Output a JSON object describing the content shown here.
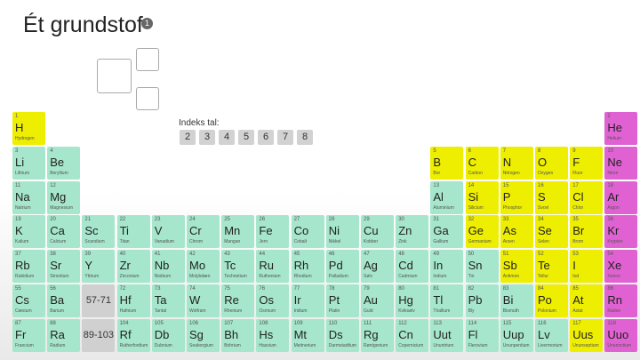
{
  "header": {
    "title": "Ét grundstof",
    "badge": "1"
  },
  "index_label": "Indeks tal:",
  "index_buttons": [
    "2",
    "3",
    "4",
    "5",
    "6",
    "7",
    "8"
  ],
  "ranges": [
    "57-71",
    "89-103"
  ],
  "colors": {
    "metal": "#a5e6cc",
    "nonmetal": "#eeee00",
    "noble": "#e062d2",
    "range": "#d0d0d0"
  },
  "elements": [
    {
      "n": "1",
      "s": "H",
      "name": "Hydrogen",
      "t": "nonmetal"
    },
    {
      "n": "2",
      "s": "He",
      "name": "Helium",
      "t": "noble"
    },
    {
      "n": "3",
      "s": "Li",
      "name": "Lithium",
      "t": "metal"
    },
    {
      "n": "4",
      "s": "Be",
      "name": "Beryllium",
      "t": "metal"
    },
    {
      "n": "5",
      "s": "B",
      "name": "Bor",
      "t": "nonmetal"
    },
    {
      "n": "6",
      "s": "C",
      "name": "Carbon",
      "t": "nonmetal"
    },
    {
      "n": "7",
      "s": "N",
      "name": "Nitrogen",
      "t": "nonmetal"
    },
    {
      "n": "8",
      "s": "O",
      "name": "Oxygen",
      "t": "nonmetal"
    },
    {
      "n": "9",
      "s": "F",
      "name": "Fluor",
      "t": "nonmetal"
    },
    {
      "n": "10",
      "s": "Ne",
      "name": "Neon",
      "t": "noble"
    },
    {
      "n": "11",
      "s": "Na",
      "name": "Natrium",
      "t": "metal"
    },
    {
      "n": "12",
      "s": "Mg",
      "name": "Magnesium",
      "t": "metal"
    },
    {
      "n": "13",
      "s": "Al",
      "name": "Aluminium",
      "t": "metal"
    },
    {
      "n": "14",
      "s": "Si",
      "name": "Silicium",
      "t": "nonmetal"
    },
    {
      "n": "15",
      "s": "P",
      "name": "Phosphor",
      "t": "nonmetal"
    },
    {
      "n": "16",
      "s": "S",
      "name": "Svovl",
      "t": "nonmetal"
    },
    {
      "n": "17",
      "s": "Cl",
      "name": "Chlor",
      "t": "nonmetal"
    },
    {
      "n": "18",
      "s": "Ar",
      "name": "Argon",
      "t": "noble"
    },
    {
      "n": "19",
      "s": "K",
      "name": "Kalium",
      "t": "metal"
    },
    {
      "n": "20",
      "s": "Ca",
      "name": "Calcium",
      "t": "metal"
    },
    {
      "n": "21",
      "s": "Sc",
      "name": "Scandium",
      "t": "metal"
    },
    {
      "n": "22",
      "s": "Ti",
      "name": "Titan",
      "t": "metal"
    },
    {
      "n": "23",
      "s": "V",
      "name": "Vanadium",
      "t": "metal"
    },
    {
      "n": "24",
      "s": "Cr",
      "name": "Chrom",
      "t": "metal"
    },
    {
      "n": "25",
      "s": "Mn",
      "name": "Mangan",
      "t": "metal"
    },
    {
      "n": "26",
      "s": "Fe",
      "name": "Jern",
      "t": "metal"
    },
    {
      "n": "27",
      "s": "Co",
      "name": "Cobalt",
      "t": "metal"
    },
    {
      "n": "28",
      "s": "Ni",
      "name": "Nikkel",
      "t": "metal"
    },
    {
      "n": "29",
      "s": "Cu",
      "name": "Kobber",
      "t": "metal"
    },
    {
      "n": "30",
      "s": "Zn",
      "name": "Zink",
      "t": "metal"
    },
    {
      "n": "31",
      "s": "Ga",
      "name": "Gallium",
      "t": "metal"
    },
    {
      "n": "32",
      "s": "Ge",
      "name": "Germanium",
      "t": "nonmetal"
    },
    {
      "n": "33",
      "s": "As",
      "name": "Arsen",
      "t": "nonmetal"
    },
    {
      "n": "34",
      "s": "Se",
      "name": "Selen",
      "t": "nonmetal"
    },
    {
      "n": "35",
      "s": "Br",
      "name": "Brom",
      "t": "nonmetal"
    },
    {
      "n": "36",
      "s": "Kr",
      "name": "Krypton",
      "t": "noble"
    },
    {
      "n": "37",
      "s": "Rb",
      "name": "Rubidium",
      "t": "metal"
    },
    {
      "n": "38",
      "s": "Sr",
      "name": "Strontium",
      "t": "metal"
    },
    {
      "n": "39",
      "s": "Y",
      "name": "Yttrium",
      "t": "metal"
    },
    {
      "n": "40",
      "s": "Zr",
      "name": "Zirconium",
      "t": "metal"
    },
    {
      "n": "41",
      "s": "Nb",
      "name": "Niobium",
      "t": "metal"
    },
    {
      "n": "42",
      "s": "Mo",
      "name": "Molybdæn",
      "t": "metal"
    },
    {
      "n": "43",
      "s": "Tc",
      "name": "Technetium",
      "t": "metal"
    },
    {
      "n": "44",
      "s": "Ru",
      "name": "Ruthenium",
      "t": "metal"
    },
    {
      "n": "45",
      "s": "Rh",
      "name": "Rhodium",
      "t": "metal"
    },
    {
      "n": "46",
      "s": "Pd",
      "name": "Palladium",
      "t": "metal"
    },
    {
      "n": "47",
      "s": "Ag",
      "name": "Sølv",
      "t": "metal"
    },
    {
      "n": "48",
      "s": "Cd",
      "name": "Cadmium",
      "t": "metal"
    },
    {
      "n": "49",
      "s": "In",
      "name": "Indium",
      "t": "metal"
    },
    {
      "n": "50",
      "s": "Sn",
      "name": "Tin",
      "t": "metal"
    },
    {
      "n": "51",
      "s": "Sb",
      "name": "Antimon",
      "t": "nonmetal"
    },
    {
      "n": "52",
      "s": "Te",
      "name": "Tellur",
      "t": "nonmetal"
    },
    {
      "n": "53",
      "s": "I",
      "name": "Iod",
      "t": "nonmetal"
    },
    {
      "n": "54",
      "s": "Xe",
      "name": "Xenon",
      "t": "noble"
    },
    {
      "n": "55",
      "s": "Cs",
      "name": "Cæsium",
      "t": "metal"
    },
    {
      "n": "56",
      "s": "Ba",
      "name": "Barium",
      "t": "metal"
    },
    {
      "n": "72",
      "s": "Hf",
      "name": "Hafnium",
      "t": "metal"
    },
    {
      "n": "73",
      "s": "Ta",
      "name": "Tantal",
      "t": "metal"
    },
    {
      "n": "74",
      "s": "W",
      "name": "Wolfram",
      "t": "metal"
    },
    {
      "n": "75",
      "s": "Re",
      "name": "Rhenium",
      "t": "metal"
    },
    {
      "n": "76",
      "s": "Os",
      "name": "Osmium",
      "t": "metal"
    },
    {
      "n": "77",
      "s": "Ir",
      "name": "Iridium",
      "t": "metal"
    },
    {
      "n": "78",
      "s": "Pt",
      "name": "Platin",
      "t": "metal"
    },
    {
      "n": "79",
      "s": "Au",
      "name": "Guld",
      "t": "metal"
    },
    {
      "n": "80",
      "s": "Hg",
      "name": "Kviksølv",
      "t": "metal"
    },
    {
      "n": "81",
      "s": "Tl",
      "name": "Thallium",
      "t": "metal"
    },
    {
      "n": "82",
      "s": "Pb",
      "name": "Bly",
      "t": "metal"
    },
    {
      "n": "83",
      "s": "Bi",
      "name": "Bismuth",
      "t": "metal"
    },
    {
      "n": "84",
      "s": "Po",
      "name": "Polonium",
      "t": "nonmetal"
    },
    {
      "n": "85",
      "s": "At",
      "name": "Astat",
      "t": "nonmetal"
    },
    {
      "n": "86",
      "s": "Rn",
      "name": "Radon",
      "t": "noble"
    },
    {
      "n": "87",
      "s": "Fr",
      "name": "Francium",
      "t": "metal"
    },
    {
      "n": "88",
      "s": "Ra",
      "name": "Radium",
      "t": "metal"
    },
    {
      "n": "104",
      "s": "Rf",
      "name": "Rutherfordium",
      "t": "metal"
    },
    {
      "n": "105",
      "s": "Db",
      "name": "Dubnium",
      "t": "metal"
    },
    {
      "n": "106",
      "s": "Sg",
      "name": "Seaborgium",
      "t": "metal"
    },
    {
      "n": "107",
      "s": "Bh",
      "name": "Bohrium",
      "t": "metal"
    },
    {
      "n": "108",
      "s": "Hs",
      "name": "Hassium",
      "t": "metal"
    },
    {
      "n": "109",
      "s": "Mt",
      "name": "Meitnerium",
      "t": "metal"
    },
    {
      "n": "110",
      "s": "Ds",
      "name": "Darmstadtium",
      "t": "metal"
    },
    {
      "n": "111",
      "s": "Rg",
      "name": "Røntgenium",
      "t": "metal"
    },
    {
      "n": "112",
      "s": "Cn",
      "name": "Copernicium",
      "t": "metal"
    },
    {
      "n": "113",
      "s": "Uut",
      "name": "Ununtrium",
      "t": "metal"
    },
    {
      "n": "114",
      "s": "Fl",
      "name": "Flerovium",
      "t": "metal"
    },
    {
      "n": "115",
      "s": "Uup",
      "name": "Ununpentium",
      "t": "metal"
    },
    {
      "n": "116",
      "s": "Lv",
      "name": "Livermorium",
      "t": "metal"
    },
    {
      "n": "117",
      "s": "Uus",
      "name": "Ununseptium",
      "t": "nonmetal"
    },
    {
      "n": "118",
      "s": "Uuo",
      "name": "Ununoctium",
      "t": "noble"
    }
  ]
}
